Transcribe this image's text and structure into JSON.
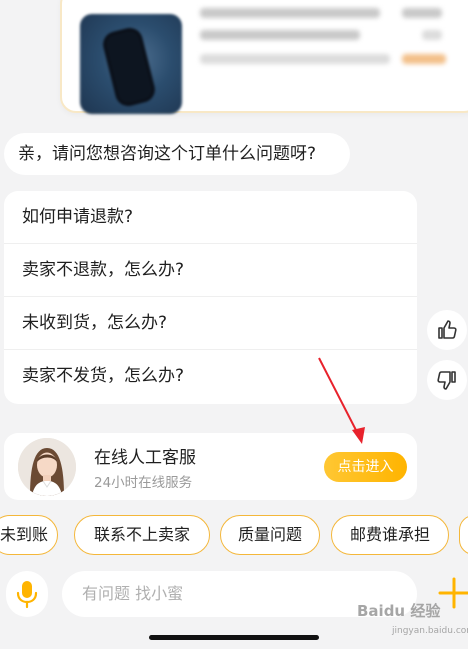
{
  "greeting_question": "亲，请问您想咨询这个订单什么问题呀?",
  "faq": [
    "如何申请退款?",
    "卖家不退款，怎么办?",
    "未收到货，怎么办?",
    "卖家不发货，怎么办?"
  ],
  "agent": {
    "name": "在线人工客服",
    "subtitle": "24小时在线服务",
    "enter_label": "点击进入"
  },
  "chips": [
    "未到账",
    "联系不上卖家",
    "质量问题",
    "邮费谁承担"
  ],
  "input": {
    "placeholder": "有问题 找小蜜"
  },
  "watermark": {
    "main": "Baidu 经验",
    "sub": "jingyan.baidu.com"
  },
  "colors": {
    "accent": "#ffb400",
    "chip_border": "#f4b73a",
    "arrow": "#e8222c"
  }
}
